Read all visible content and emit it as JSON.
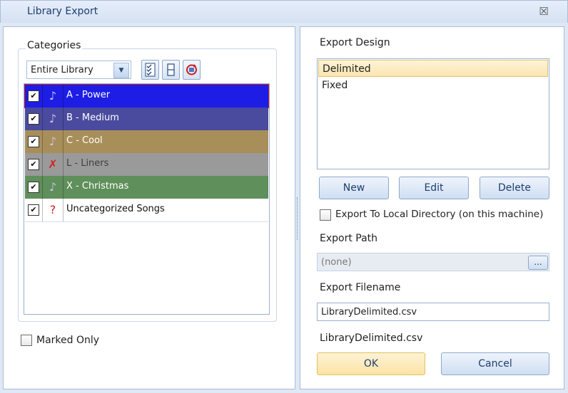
{
  "window": {
    "title": "Library Export",
    "close_symbol": "☒"
  },
  "categories": {
    "label": "Categories",
    "filter_value": "Entire Library",
    "items": [
      {
        "label": "A - Power",
        "checked": true,
        "icon": "music-note-icon",
        "bg": "#1d1de6",
        "color": "#ffffff"
      },
      {
        "label": "B - Medium",
        "checked": true,
        "icon": "music-note-icon",
        "bg": "#4a4a9e",
        "color": "#ffffff"
      },
      {
        "label": "C - Cool",
        "checked": true,
        "icon": "music-note-icon",
        "bg": "#a88f5a",
        "color": "#ffffff"
      },
      {
        "label": "L - Liners",
        "checked": true,
        "icon": "crossed-note-icon",
        "bg": "#9a9a9a",
        "color": "#3f3f3f"
      },
      {
        "label": "X - Christmas",
        "checked": true,
        "icon": "music-note-icon",
        "bg": "#5f8f5a",
        "color": "#ffffff"
      },
      {
        "label": "Uncategorized Songs",
        "checked": true,
        "icon": "question-note-icon",
        "bg": "#ffffff",
        "color": "#111111"
      }
    ],
    "marked_only_label": "Marked Only"
  },
  "export": {
    "design_label": "Export Design",
    "designs": [
      {
        "label": "Delimited",
        "selected": true
      },
      {
        "label": "Fixed",
        "selected": false
      }
    ],
    "new_label": "New",
    "edit_label": "Edit",
    "delete_label": "Delete",
    "local_dir_label": "Export To Local Directory (on this machine)",
    "path_label": "Export Path",
    "path_value": "(none)",
    "browse_label": "...",
    "filename_label": "Export Filename",
    "filename_value": "LibraryDelimited.csv",
    "filename_preview": "LibraryDelimited.csv",
    "ok_label": "OK",
    "cancel_label": "Cancel"
  }
}
